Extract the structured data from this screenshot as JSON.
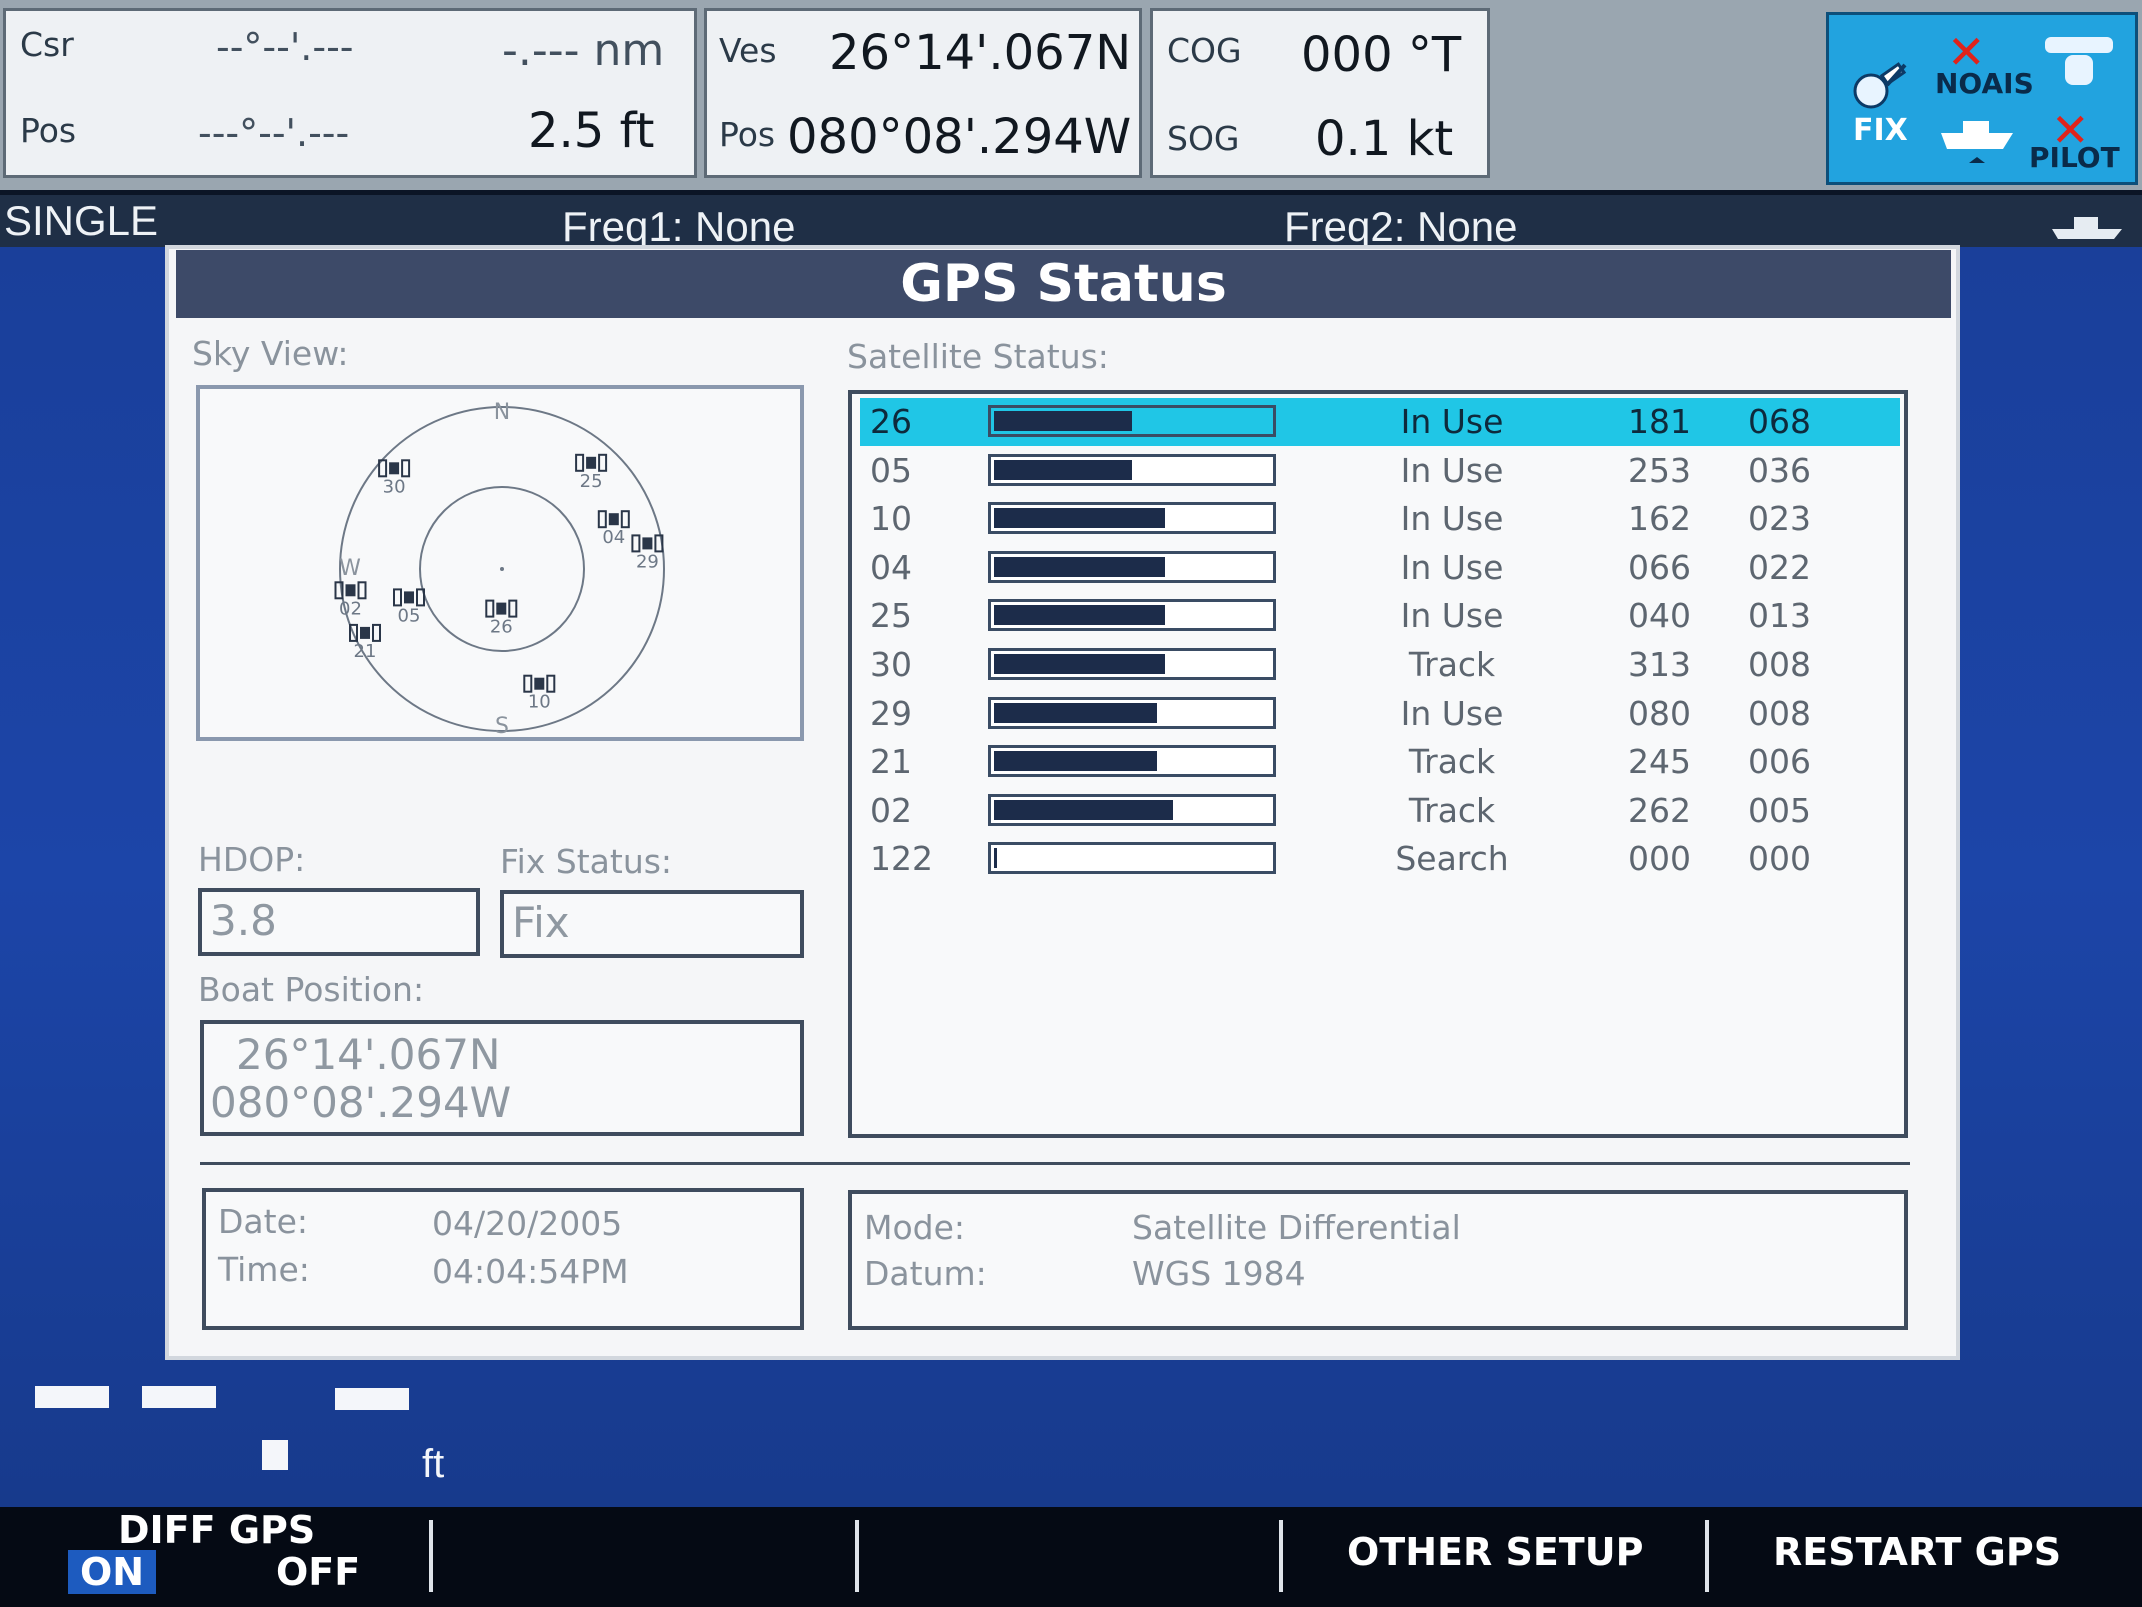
{
  "topbar": {
    "csr_label": "Csr",
    "csr_pos": "--°--'.---",
    "csr_range": "-.--- nm",
    "pos_label": "Pos",
    "pos_pos": "---°--'.---",
    "pos_depth": "2.5 ft",
    "ves_label": "Ves",
    "ves_lat": "26°14'.067N",
    "ves_pos_label": "Pos",
    "ves_lon": "080°08'.294W",
    "cog_label": "COG",
    "cog_value": "000 °T",
    "sog_label": "SOG",
    "sog_value": "0.1 kt"
  },
  "status_icons": {
    "fix": "FIX",
    "noais": "NOAIS",
    "pilot": "PILOT"
  },
  "strip": {
    "mode": "SINGLE",
    "freq1": "Freq1: None",
    "freq2": "Freq2: None"
  },
  "dialog": {
    "title": "GPS Status",
    "sky_view_label": "Sky View:",
    "satellite_status_label": "Satellite Status:",
    "hdop_label": "HDOP:",
    "hdop_value": "3.8",
    "fix_status_label": "Fix Status:",
    "fix_status_value": "Fix",
    "boat_position_label": "Boat Position:",
    "boat_lat": "26°14'.067N",
    "boat_lon": "080°08'.294W",
    "date_label": "Date:",
    "date_value": "04/20/2005",
    "time_label": "Time:",
    "time_value": "04:04:54PM",
    "mode_label": "Mode:",
    "mode_value": "Satellite Differential",
    "datum_label": "Datum:",
    "datum_value": "WGS 1984"
  },
  "skyview": {
    "compass": {
      "north": "N",
      "south": "S",
      "west": "W"
    },
    "satellites": [
      {
        "id": "30",
        "azimuth": 313,
        "elevation": 8
      },
      {
        "id": "25",
        "azimuth": 40,
        "elevation": 13
      },
      {
        "id": "04",
        "azimuth": 66,
        "elevation": 22
      },
      {
        "id": "29",
        "azimuth": 80,
        "elevation": 8
      },
      {
        "id": "02",
        "azimuth": 262,
        "elevation": 5
      },
      {
        "id": "05",
        "azimuth": 253,
        "elevation": 36
      },
      {
        "id": "21",
        "azimuth": 245,
        "elevation": 6
      },
      {
        "id": "26",
        "azimuth": 181,
        "elevation": 68
      },
      {
        "id": "10",
        "azimuth": 162,
        "elevation": 23
      }
    ]
  },
  "satellites": [
    {
      "prn": "26",
      "signal": 0.5,
      "status": "In Use",
      "azimuth": "181",
      "elevation": "068",
      "selected": true
    },
    {
      "prn": "05",
      "signal": 0.5,
      "status": "In Use",
      "azimuth": "253",
      "elevation": "036",
      "selected": false
    },
    {
      "prn": "10",
      "signal": 0.62,
      "status": "In Use",
      "azimuth": "162",
      "elevation": "023",
      "selected": false
    },
    {
      "prn": "04",
      "signal": 0.62,
      "status": "In Use",
      "azimuth": "066",
      "elevation": "022",
      "selected": false
    },
    {
      "prn": "25",
      "signal": 0.62,
      "status": "In Use",
      "azimuth": "040",
      "elevation": "013",
      "selected": false
    },
    {
      "prn": "30",
      "signal": 0.62,
      "status": "Track",
      "azimuth": "313",
      "elevation": "008",
      "selected": false
    },
    {
      "prn": "29",
      "signal": 0.59,
      "status": "In Use",
      "azimuth": "080",
      "elevation": "008",
      "selected": false
    },
    {
      "prn": "21",
      "signal": 0.59,
      "status": "Track",
      "azimuth": "245",
      "elevation": "006",
      "selected": false
    },
    {
      "prn": "02",
      "signal": 0.65,
      "status": "Track",
      "azimuth": "262",
      "elevation": "005",
      "selected": false
    },
    {
      "prn": "122",
      "signal": 0.01,
      "status": "Search",
      "azimuth": "000",
      "elevation": "000",
      "selected": false
    }
  ],
  "background": {
    "depth_unit": "ft"
  },
  "softkeys": {
    "diff_gps": "DIFF GPS",
    "on": "ON",
    "off": "OFF",
    "other_setup": "OTHER SETUP",
    "restart_gps": "RESTART GPS"
  },
  "colors": {
    "accent_cyan": "#20c6e6",
    "title_bar": "#3d4a68",
    "status_icon_bg": "#22a3df",
    "map_blue": "#1c45a8",
    "signal_bar": "#1c2c4a"
  }
}
